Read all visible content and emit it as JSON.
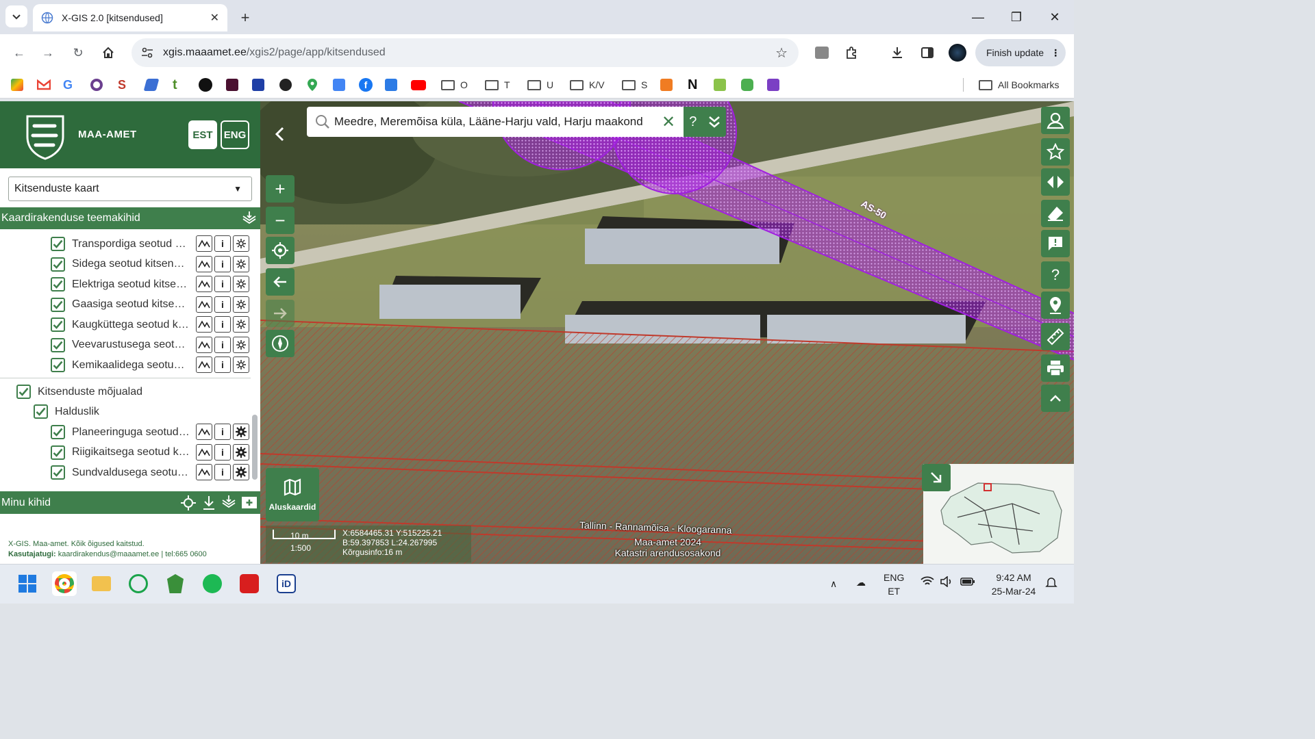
{
  "browser": {
    "tab_title": "X-GIS 2.0 [kitsendused]",
    "url_host": "xgis.maaamet.ee",
    "url_path": "/xgis2/page/app/kitsendused",
    "finish_update": "Finish update",
    "bookmarks": [
      {
        "label": "O"
      },
      {
        "label": "T"
      },
      {
        "label": "U"
      },
      {
        "label": "K/V"
      },
      {
        "label": "S"
      }
    ],
    "all_bookmarks": "All Bookmarks"
  },
  "app": {
    "brand": "Maa-amet",
    "lang_est": "EST",
    "lang_eng": "ENG",
    "map_select": "Kitsenduste kaart",
    "theme_layers_title": "Kaardirakenduse teemakihid",
    "layers": [
      {
        "label": "Transpordiga seotud kitsendused"
      },
      {
        "label": "Sidega seotud kitsendused"
      },
      {
        "label": "Elektriga seotud kitsendused"
      },
      {
        "label": "Gaasiga seotud kitsendused"
      },
      {
        "label": "Kaugküttega seotud kitsendused"
      },
      {
        "label": "Veevarustusega seotud kitsendused"
      },
      {
        "label": "Kemikaalidega seotud kitsendused"
      }
    ],
    "group_label": "Kitsenduste mõjualad",
    "subgroup_label": "Halduslik",
    "sublayers": [
      {
        "label": "Planeeringuga seotud kitsendused"
      },
      {
        "label": "Riigikaitsega seotud kitsendused"
      },
      {
        "label": "Sundvaldusega seotud kitsendused"
      }
    ],
    "my_layers": "Minu kihid",
    "footer_line1": "X-GIS. Maa-amet. Kõik õigused kaitstud.",
    "footer_contact_label": "Kasutajatugi:",
    "footer_contact": " kaardirakendus@maaamet.ee | tel:665 0600"
  },
  "map": {
    "search_value": "Meedre, Meremõisa küla, Lääne-Harju vald, Harju maakond",
    "search_help": "?",
    "line_label": "AS-50",
    "road_label": "Tallinn - Rannamõisa - Kloogaranna",
    "basemap_label": "Aluskaardid",
    "scale_distance": "10 m",
    "scale_ratio": "1:500",
    "coord_xy": "X:6584465.31 Y:515225.21",
    "coord_bl": "B:59.397853 L:24.267995",
    "height": "Kõrgusinfo:16 m",
    "credit1": "Maa-amet 2024",
    "credit2": "Katastri arendusosakond"
  },
  "taskbar": {
    "lang_top": "ENG",
    "lang_bottom": "ET",
    "time": "9:42 AM",
    "date": "25-Mar-24"
  },
  "colors": {
    "brand_green": "#2e6b3c",
    "accent_green": "#3f7f4c",
    "restriction_purple": "#9a1fd0",
    "restriction_red": "#c62828"
  }
}
